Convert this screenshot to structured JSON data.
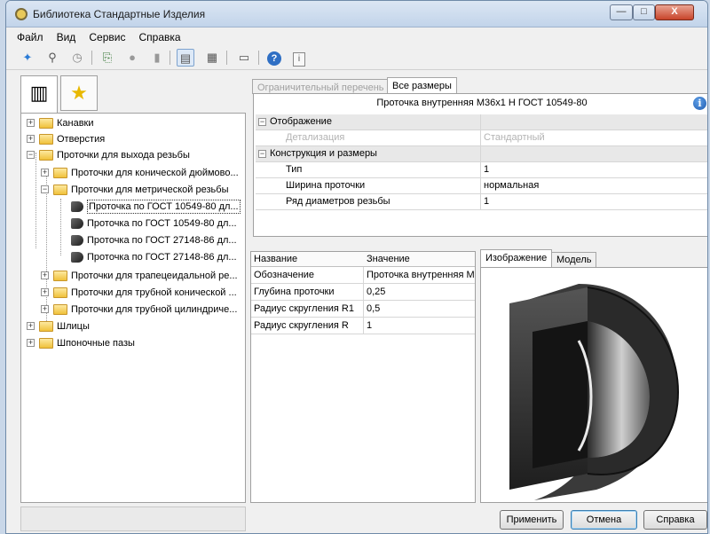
{
  "window": {
    "title": "Библиотека Стандартные Изделия",
    "controls": {
      "minimize": "—",
      "maximize": "□",
      "close": "X"
    }
  },
  "menu": [
    "Файл",
    "Вид",
    "Сервис",
    "Справка"
  ],
  "toolbar": [
    "pin-icon",
    "binoculars-icon",
    "clock-icon",
    "export-icon",
    "sphere-icon",
    "gallery-icon",
    "view-list-icon",
    "view-table-icon",
    "view-panel-icon",
    "help-icon",
    "info-icon"
  ],
  "left_tabs": [
    "catalog-icon",
    "favorites-star-icon"
  ],
  "tree": [
    {
      "label": "Канавки",
      "level": 0,
      "type": "folder",
      "expander": "+"
    },
    {
      "label": "Отверстия",
      "level": 0,
      "type": "folder",
      "expander": "+"
    },
    {
      "label": "Проточки для выхода резьбы",
      "level": 0,
      "type": "folder",
      "expander": "−"
    },
    {
      "label": "Проточки для конической дюймово...",
      "level": 1,
      "type": "folder",
      "expander": "+"
    },
    {
      "label": "Проточки для метрической резьбы",
      "level": 1,
      "type": "folder",
      "expander": "−"
    },
    {
      "label": "Проточка по ГОСТ 10549-80 дл...",
      "level": 2,
      "type": "leaf",
      "selected": true
    },
    {
      "label": "Проточка по ГОСТ 10549-80 дл...",
      "level": 2,
      "type": "leaf"
    },
    {
      "label": "Проточка по ГОСТ 27148-86 дл...",
      "level": 2,
      "type": "leaf"
    },
    {
      "label": "Проточка по ГОСТ 27148-86 дл...",
      "level": 2,
      "type": "leaf"
    },
    {
      "label": "Проточки для трапецеидальной ре...",
      "level": 1,
      "type": "folder",
      "expander": "+"
    },
    {
      "label": "Проточки для трубной конической ...",
      "level": 1,
      "type": "folder",
      "expander": "+"
    },
    {
      "label": "Проточки для трубной цилиндриче...",
      "level": 1,
      "type": "folder",
      "expander": "+"
    },
    {
      "label": "Шлицы",
      "level": 0,
      "type": "folder",
      "expander": "+"
    },
    {
      "label": "Шпоночные пазы",
      "level": 0,
      "type": "folder",
      "expander": "+"
    }
  ],
  "right_tabs": {
    "disabled": "Ограничительный перечень",
    "active": "Все размеры"
  },
  "properties": {
    "header": "Проточка внутренняя М36x1 Н ГОСТ 10549-80",
    "info_icon": "i",
    "rows": [
      {
        "key": "Отображение",
        "value": "",
        "type": "category",
        "expander": "−"
      },
      {
        "key": "Детализация",
        "value": "Стандартный",
        "type": "disabled"
      },
      {
        "key": "Конструкция и размеры",
        "value": "",
        "type": "category",
        "expander": "−"
      },
      {
        "key": "Тип",
        "value": "1",
        "type": "item"
      },
      {
        "key": "Ширина проточки",
        "value": "нормальная",
        "type": "item"
      },
      {
        "key": "Ряд диаметров резьбы",
        "value": "1",
        "type": "item"
      }
    ]
  },
  "params_table": {
    "columns": [
      "Название",
      "Значение"
    ],
    "rows": [
      [
        "Обозначение",
        "Проточка внутренняя М"
      ],
      [
        "Глубина проточки",
        "0,25"
      ],
      [
        "Радиус скругления R1",
        "0,5"
      ],
      [
        "Радиус скругления R",
        "1"
      ]
    ]
  },
  "image_tabs": {
    "active": "Изображение",
    "inactive": "Модель"
  },
  "preview": {
    "subject": "3d-part-preview",
    "colors": {
      "dark": "#1e1e1e",
      "mid": "#6e6e6e",
      "light": "#cfcfcf"
    }
  },
  "buttons": {
    "apply": "Применить",
    "cancel": "Отмена",
    "help": "Справка"
  }
}
